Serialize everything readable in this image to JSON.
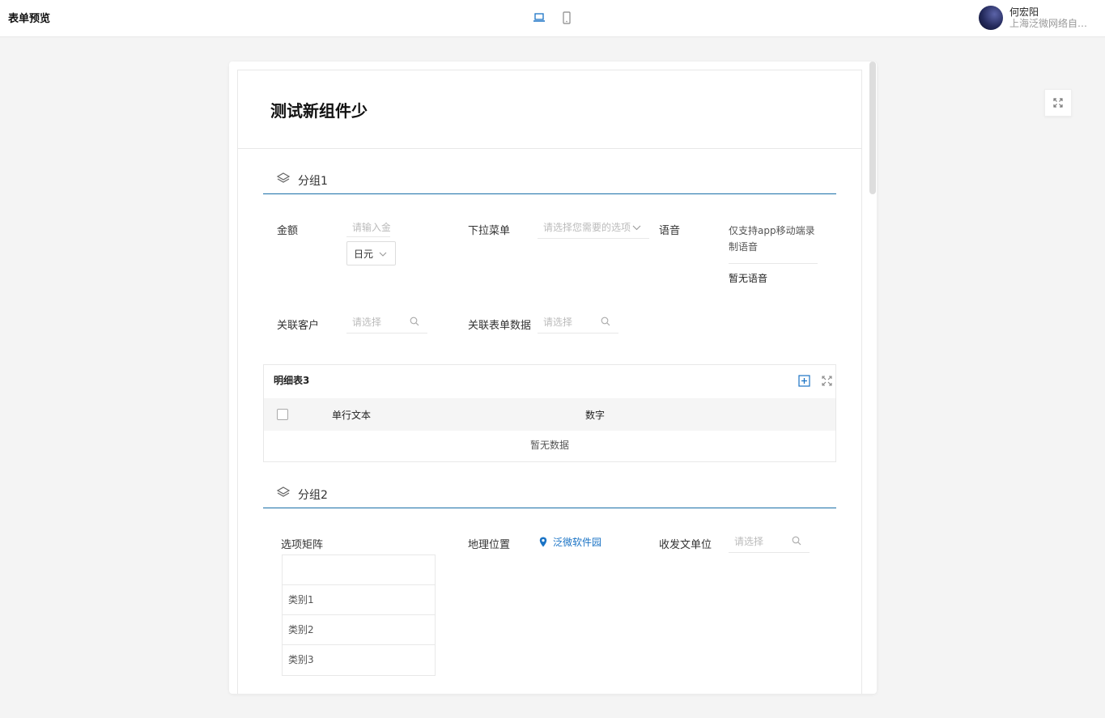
{
  "header": {
    "title": "表单预览",
    "user_name": "何宏阳",
    "user_org": "上海泛微网络自动化有限公司"
  },
  "device_toggle": {
    "desktop": "laptop-icon",
    "mobile": "mobile-icon",
    "active": "desktop",
    "accent_color": "#1a73c5"
  },
  "form": {
    "title": "测试新组件少",
    "group1": {
      "label": "分组1",
      "amount": {
        "label": "金额",
        "placeholder": "请输入金额",
        "currency": "日元"
      },
      "dropdown": {
        "label": "下拉菜单",
        "placeholder": "请选择您需要的选项"
      },
      "voice": {
        "label": "语音",
        "note": "仅支持app移动端录制语音",
        "empty": "暂无语音"
      },
      "customer": {
        "label": "关联客户",
        "placeholder": "请选择"
      },
      "form_data": {
        "label": "关联表单数据",
        "placeholder": "请选择"
      }
    },
    "detail_table": {
      "title": "明细表3",
      "columns": [
        "单行文本",
        "数字"
      ],
      "empty": "暂无数据"
    },
    "group2": {
      "label": "分组2",
      "matrix": {
        "label": "选项矩阵",
        "rows": [
          "类别1",
          "类别2",
          "类别3"
        ]
      },
      "location": {
        "label": "地理位置",
        "value": "泛微软件园"
      },
      "units": {
        "label": "收发文单位",
        "placeholder": "请选择"
      }
    }
  }
}
